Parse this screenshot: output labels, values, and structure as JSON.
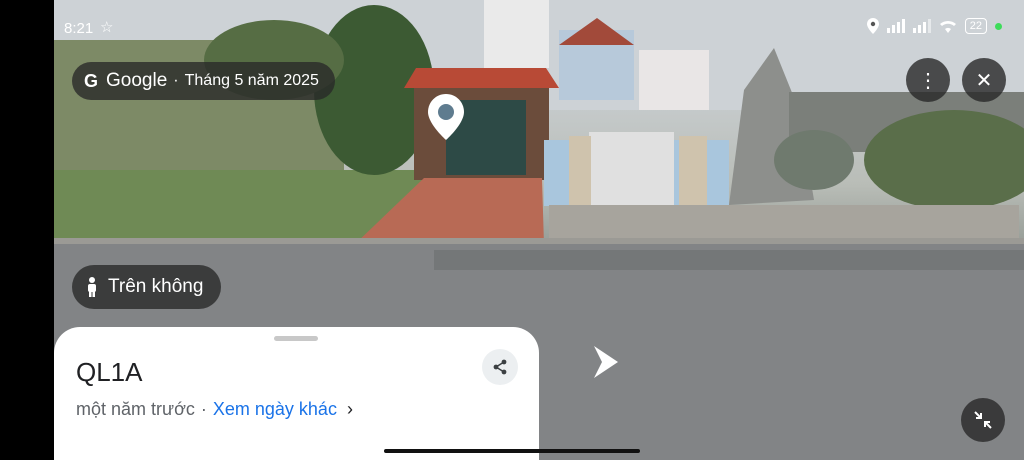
{
  "status_bar": {
    "time": "8:21",
    "battery": "22"
  },
  "streetview": {
    "provider": "Google",
    "capture_date": "Tháng 5 năm 2025",
    "aerial_label": "Trên không",
    "road_name": "QL1A",
    "relative_time": "một năm trước",
    "other_dates_link": "Xem ngày khác"
  },
  "icons": {
    "star": "star-icon",
    "location": "location-icon",
    "signal": "signal-icon",
    "wifi": "wifi-icon",
    "more": "more-vert-icon",
    "close": "close-icon",
    "person": "person-icon",
    "share": "share-icon",
    "collapse": "collapse-icon",
    "arrow": "chevron-right-icon",
    "pin": "map-pin-icon"
  },
  "colors": {
    "link": "#1a73e8",
    "chip_bg": "#282828",
    "sheet_bg": "#ffffff"
  }
}
